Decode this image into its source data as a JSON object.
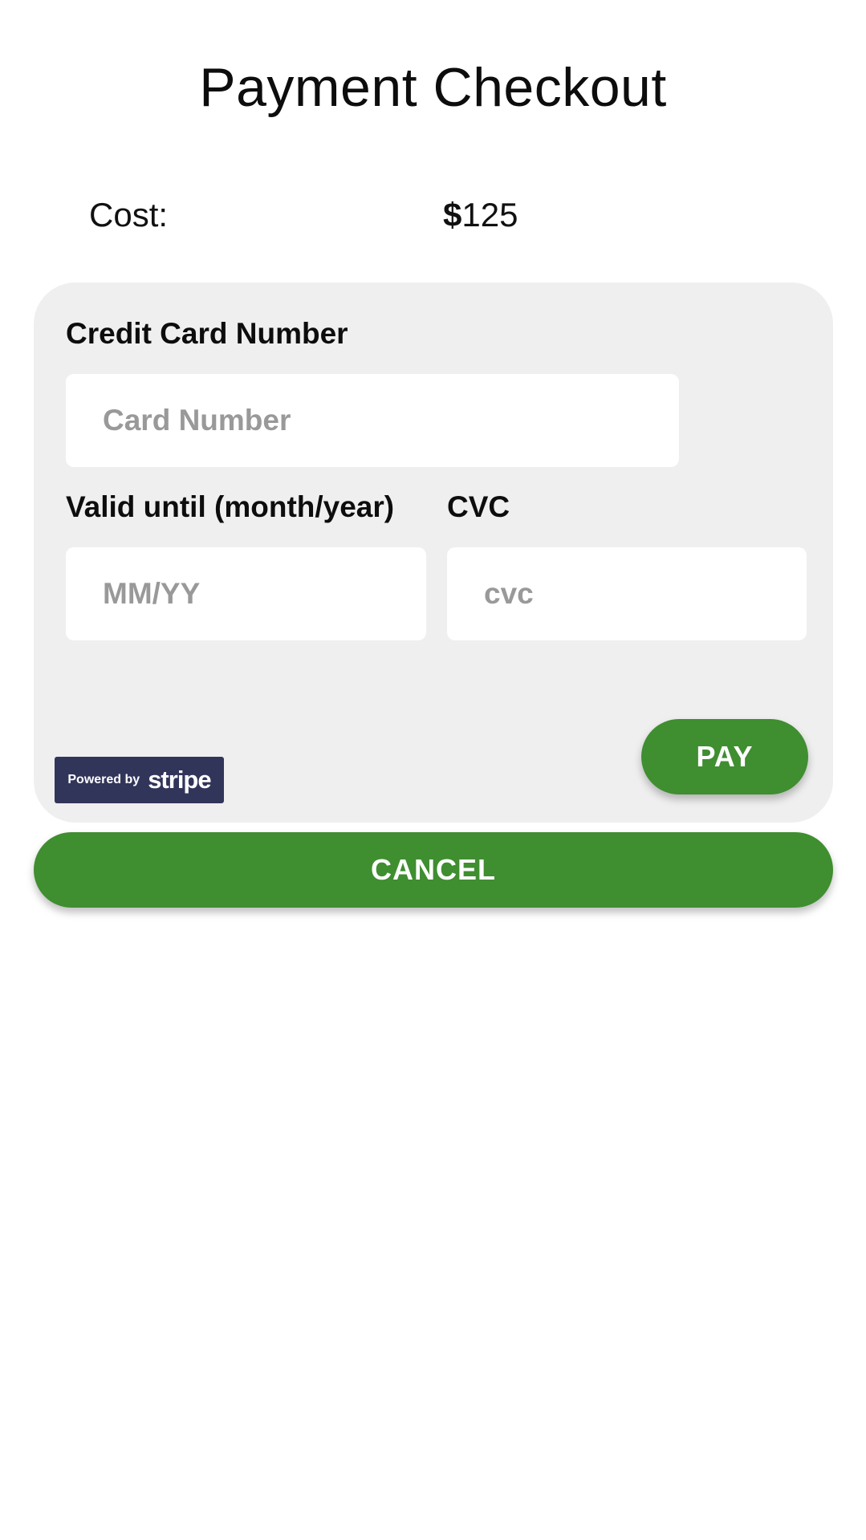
{
  "header": {
    "title": "Payment Checkout"
  },
  "summary": {
    "cost_label": "Cost:",
    "currency_symbol": "$",
    "amount": "125"
  },
  "card_form": {
    "card_number": {
      "label": "Credit Card Number",
      "placeholder": "Card Number",
      "value": ""
    },
    "expiry": {
      "label": "Valid until (month/year)",
      "placeholder": "MM/YY",
      "value": ""
    },
    "cvc": {
      "label": "CVC",
      "placeholder": "cvc",
      "value": ""
    },
    "pay_label": "PAY",
    "badge": {
      "powered_text": "Powered by",
      "brand_text": "stripe"
    }
  },
  "actions": {
    "cancel_label": "CANCEL"
  },
  "colors": {
    "primary_green": "#3f8e30",
    "panel_bg": "#efefef",
    "badge_bg": "#32355a",
    "placeholder_text": "#999999"
  }
}
